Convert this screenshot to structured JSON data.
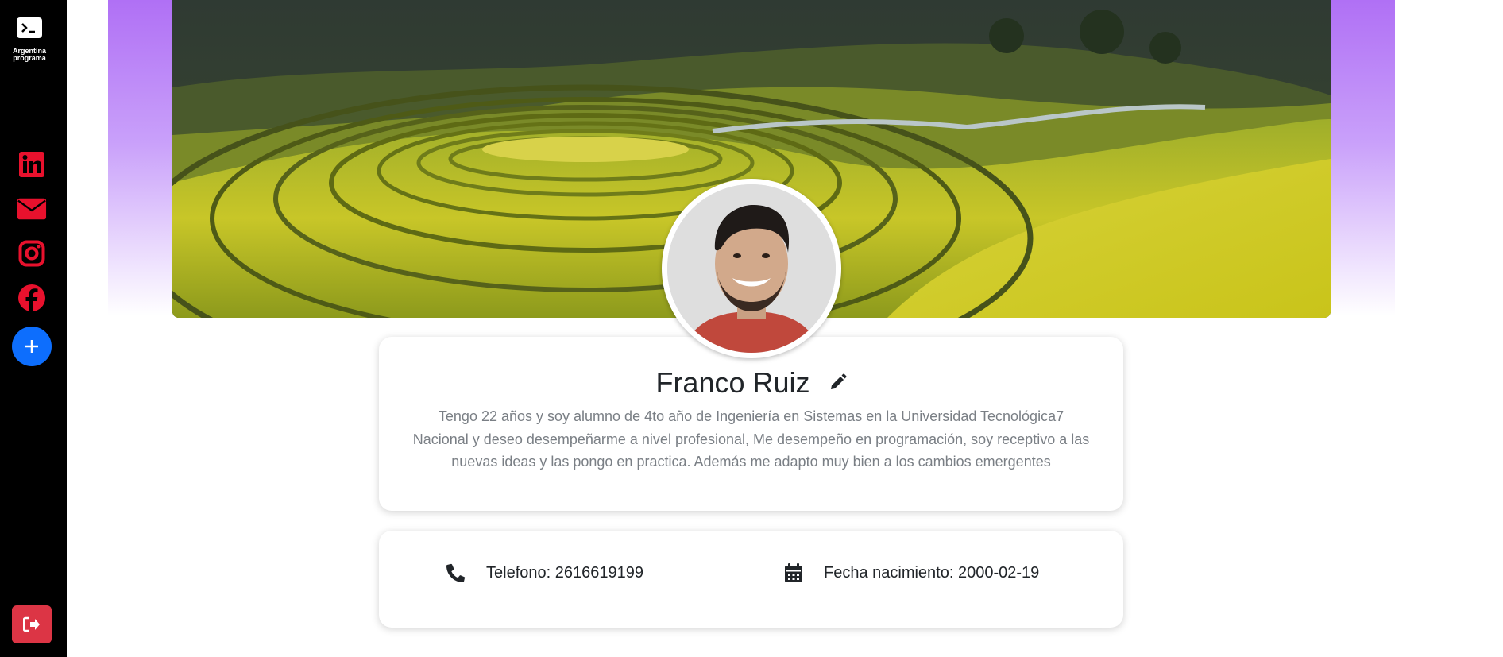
{
  "sidebar": {
    "brand_line1": "Argentina",
    "brand_line2": "programa",
    "social": [
      {
        "icon": "linkedin-icon",
        "color": "#e8112d"
      },
      {
        "icon": "email-icon",
        "color": "#e8112d"
      },
      {
        "icon": "instagram-icon",
        "color": "#e8112d"
      },
      {
        "icon": "facebook-icon",
        "color": "#e8112d"
      }
    ],
    "add_icon": "plus-icon",
    "logout_icon": "sign-out-icon"
  },
  "profile": {
    "name": "Franco Ruiz",
    "bio": "Tengo 22 años y soy alumno de 4to año de Ingeniería en Sistemas en la Universidad Tecnológica7 Nacional y deseo desempeñarme a nivel profesional, Me desempeño en programación, soy receptivo a las nuevas ideas y las pongo en practica. Además me adapto muy bien a los cambios emergentes",
    "phone": "Telefono: 2616619199",
    "birthdate": "Fecha nacimiento: 2000-02-19"
  },
  "colors": {
    "accent_blue": "#0d6efd",
    "danger_red": "#dc3545",
    "social_red": "#e8112d",
    "banner_purple": "#b070f5"
  }
}
